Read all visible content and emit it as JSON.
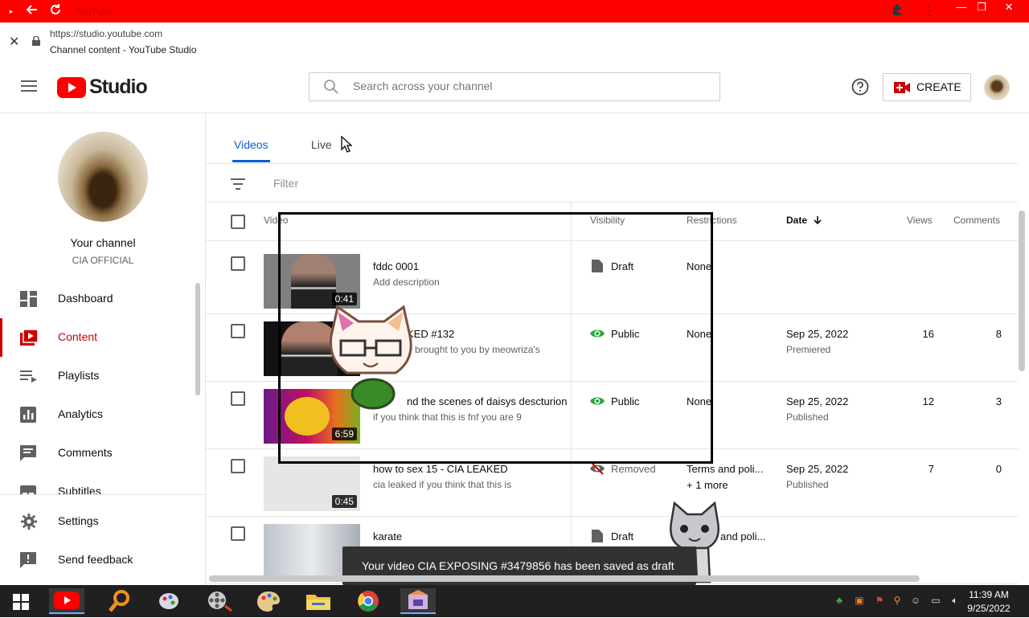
{
  "browser": {
    "tab_title": "YouTube",
    "url": "https://studio.youtube.com",
    "page_title": "Channel content - YouTube Studio"
  },
  "header": {
    "logo_text": "Studio",
    "search_placeholder": "Search across your channel",
    "create_label": "CREATE"
  },
  "channel": {
    "heading": "Your channel",
    "name": "CIA OFFICIAL"
  },
  "sidebar": {
    "items": [
      {
        "label": "Dashboard",
        "icon": "dashboard-icon"
      },
      {
        "label": "Content",
        "icon": "content-icon",
        "active": true
      },
      {
        "label": "Playlists",
        "icon": "playlists-icon"
      },
      {
        "label": "Analytics",
        "icon": "analytics-icon"
      },
      {
        "label": "Comments",
        "icon": "comments-icon"
      },
      {
        "label": "Subtitles",
        "icon": "subtitles-icon"
      }
    ],
    "bottom": [
      {
        "label": "Settings",
        "icon": "gear-icon"
      },
      {
        "label": "Send feedback",
        "icon": "feedback-icon"
      }
    ]
  },
  "tabs": [
    {
      "label": "Videos",
      "active": true
    },
    {
      "label": "Live"
    }
  ],
  "filter_placeholder": "Filter",
  "columns": {
    "video": "Video",
    "visibility": "Visibility",
    "restrictions": "Restrictions",
    "date": "Date",
    "views": "Views",
    "comments": "Comments"
  },
  "rows": [
    {
      "title": "fddc 0001",
      "desc": "Add description",
      "duration": "0:41",
      "visibility": "Draft",
      "restriction": "None",
      "restriction_more": "",
      "date": "",
      "status": "",
      "views": "",
      "comments": ""
    },
    {
      "title": "KED #132",
      "desc": "brought to you by meowriza's",
      "duration": "",
      "visibility": "Public",
      "restriction": "None",
      "restriction_more": "",
      "date": "Sep 25, 2022",
      "status": "Premiered",
      "views": "16",
      "comments": "8"
    },
    {
      "title": "nd the scenes of daisys descturion",
      "desc": "if you think that this is fnf you are 9",
      "duration": "6:59",
      "visibility": "Public",
      "restriction": "None",
      "restriction_more": "",
      "date": "Sep 25, 2022",
      "status": "Published",
      "views": "12",
      "comments": "3"
    },
    {
      "title": "how to sex 15 - CIA LEAKED",
      "desc": "cia leaked if you think that this is",
      "duration": "0:45",
      "visibility": "Removed",
      "restriction": "Terms and poli...",
      "restriction_more": "+ 1 more",
      "date": "Sep 25, 2022",
      "status": "Published",
      "views": "7",
      "comments": "0"
    },
    {
      "title": "karate",
      "desc": "",
      "duration": "",
      "visibility": "Draft",
      "restriction": "and poli...",
      "restriction_more": "",
      "date": "",
      "status": "",
      "views": "",
      "comments": ""
    }
  ],
  "toast": "Your video CIA EXPOSING #3479856 has been saved as draft",
  "taskbar": {
    "time": "11:39 AM",
    "date": "9/25/2022"
  },
  "colors": {
    "brand_red": "#ff0000",
    "active_red": "#cc0000",
    "link_blue": "#065fd4",
    "public_green": "#2ba640"
  }
}
